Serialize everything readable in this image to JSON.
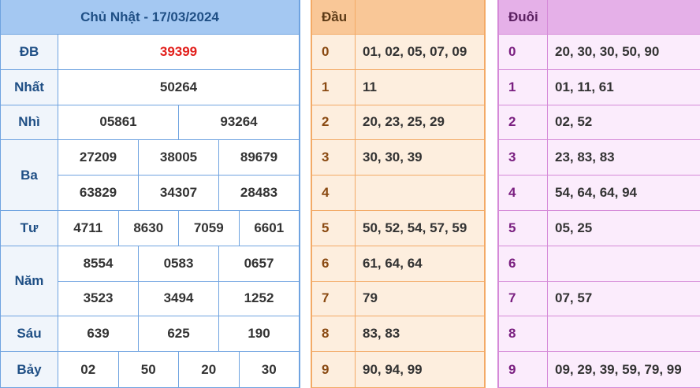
{
  "results": {
    "title": "Chủ Nhật - 17/03/2024",
    "prizes": [
      {
        "label": "ĐB",
        "lines": [
          [
            "39399"
          ]
        ],
        "special": true
      },
      {
        "label": "Nhất",
        "lines": [
          [
            "50264"
          ]
        ]
      },
      {
        "label": "Nhì",
        "lines": [
          [
            "05861",
            "93264"
          ]
        ]
      },
      {
        "label": "Ba",
        "lines": [
          [
            "27209",
            "38005",
            "89679"
          ],
          [
            "63829",
            "34307",
            "28483"
          ]
        ]
      },
      {
        "label": "Tư",
        "lines": [
          [
            "4711",
            "8630",
            "7059",
            "6601"
          ]
        ]
      },
      {
        "label": "Năm",
        "lines": [
          [
            "8554",
            "0583",
            "0657"
          ],
          [
            "3523",
            "3494",
            "1252"
          ]
        ]
      },
      {
        "label": "Sáu",
        "lines": [
          [
            "639",
            "625",
            "190"
          ]
        ]
      },
      {
        "label": "Bảy",
        "lines": [
          [
            "02",
            "50",
            "20",
            "30"
          ]
        ]
      }
    ]
  },
  "dau": {
    "header": "Đầu",
    "rows": [
      {
        "key": "0",
        "value": "01, 02, 05, 07, 09"
      },
      {
        "key": "1",
        "value": "11"
      },
      {
        "key": "2",
        "value": "20, 23, 25, 29"
      },
      {
        "key": "3",
        "value": "30, 30, 39"
      },
      {
        "key": "4",
        "value": ""
      },
      {
        "key": "5",
        "value": "50, 52, 54, 57, 59"
      },
      {
        "key": "6",
        "value": "61, 64, 64"
      },
      {
        "key": "7",
        "value": "79"
      },
      {
        "key": "8",
        "value": "83, 83"
      },
      {
        "key": "9",
        "value": "90, 94, 99"
      }
    ]
  },
  "duoi": {
    "header": "Đuôi",
    "rows": [
      {
        "key": "0",
        "value": "20, 30, 30, 50, 90"
      },
      {
        "key": "1",
        "value": "01, 11, 61"
      },
      {
        "key": "2",
        "value": "02, 52"
      },
      {
        "key": "3",
        "value": "23, 83, 83"
      },
      {
        "key": "4",
        "value": "54, 64, 64, 94"
      },
      {
        "key": "5",
        "value": "05, 25"
      },
      {
        "key": "6",
        "value": ""
      },
      {
        "key": "7",
        "value": "07, 57"
      },
      {
        "key": "8",
        "value": ""
      },
      {
        "key": "9",
        "value": "09, 29, 39, 59, 79, 99"
      }
    ]
  }
}
